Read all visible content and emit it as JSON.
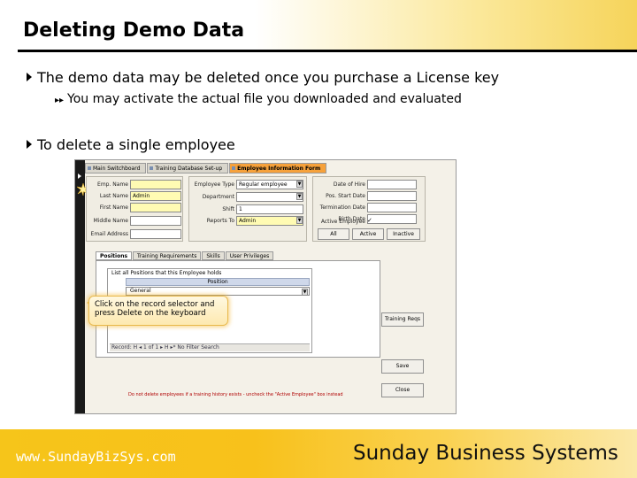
{
  "slide": {
    "title": "Deleting Demo Data",
    "bullets": [
      "The demo data may be deleted once you purchase a License key",
      "You may activate the actual file you downloaded and evaluated",
      "To delete a single employee"
    ]
  },
  "screenshot": {
    "window_tabs": [
      "Main Switchboard",
      "Training Database Set-up",
      "Employee Information Form"
    ],
    "left_fields": [
      {
        "label": "Emp. Name",
        "value": ""
      },
      {
        "label": "Last Name",
        "value": "Admin"
      },
      {
        "label": "First Name",
        "value": ""
      },
      {
        "label": "Middle Name",
        "value": ""
      },
      {
        "label": "Email Address",
        "value": ""
      }
    ],
    "mid_fields": [
      {
        "label": "Employee Type",
        "value": "Regular employee",
        "dropdown": true
      },
      {
        "label": "Department",
        "value": "",
        "dropdown": true
      },
      {
        "label": "Shift",
        "value": "1",
        "dropdown": false
      },
      {
        "label": "Reports To",
        "value": "Admin",
        "dropdown": true
      }
    ],
    "right_fields": [
      {
        "label": "Date of Hire",
        "value": ""
      },
      {
        "label": "Pos. Start Date",
        "value": ""
      },
      {
        "label": "Termination Date",
        "value": ""
      },
      {
        "label": "Birth Date",
        "value": ""
      },
      {
        "label": "Active Employee",
        "value": "✓"
      }
    ],
    "buttons": {
      "all": "All",
      "active": "Active",
      "inactive": "Inactive",
      "training_reqs": "Training Reqs",
      "save": "Save",
      "close": "Close"
    },
    "sub_tabs": [
      "Positions",
      "Training Requirements",
      "Skills",
      "User Privileges"
    ],
    "grid": {
      "caption": "List all Positions that this Employee holds",
      "header": "Position",
      "row_value": "General",
      "navbar": "Record: H  ◂  1 of 1  ▸  H  ▸*   No Filter   Search"
    },
    "callout": "Click on the record selector and press Delete on the keyboard",
    "warning": "Do not delete employees if a training history exists - uncheck the \"Active Employee\" box instead"
  },
  "footer": {
    "url": "www.SundayBizSys.com",
    "company": "Sunday Business Systems"
  },
  "colors": {
    "footer_gold": "#f6c51a",
    "active_tab": "#f6a13a",
    "required_field": "#fffbb3"
  }
}
